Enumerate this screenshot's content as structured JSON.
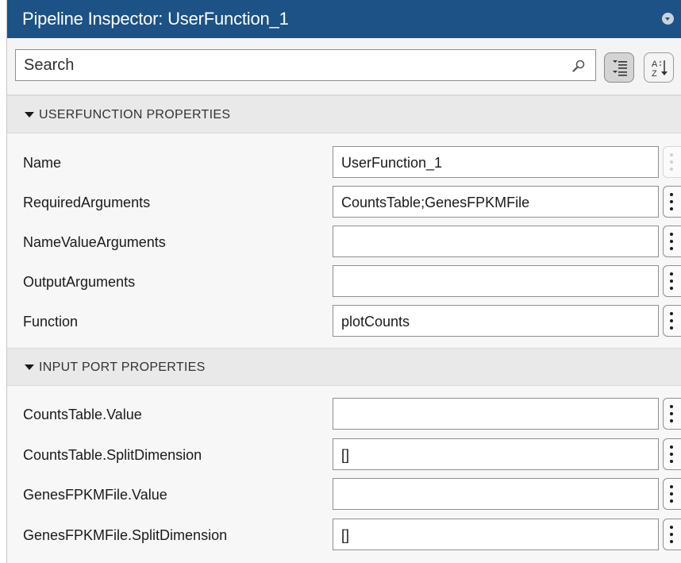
{
  "window": {
    "title": "Pipeline Inspector: UserFunction_1"
  },
  "search": {
    "placeholder": "Search",
    "value": ""
  },
  "toolbar": {
    "categorized_view": "categorized-view-icon",
    "alphabetical_view": "sort-alphabetical-icon"
  },
  "sections": [
    {
      "title": "USERFUNCTION PROPERTIES",
      "rows": [
        {
          "label": "Name",
          "value": "UserFunction_1",
          "more_enabled": false
        },
        {
          "label": "RequiredArguments",
          "value": "CountsTable;GenesFPKMFile",
          "more_enabled": true
        },
        {
          "label": "NameValueArguments",
          "value": "",
          "more_enabled": true
        },
        {
          "label": "OutputArguments",
          "value": "",
          "more_enabled": true
        },
        {
          "label": "Function",
          "value": "plotCounts",
          "more_enabled": true
        }
      ]
    },
    {
      "title": "INPUT PORT PROPERTIES",
      "rows": [
        {
          "label": "CountsTable.Value",
          "value": "",
          "more_enabled": true
        },
        {
          "label": "CountsTable.SplitDimension",
          "value": "[]",
          "more_enabled": true
        },
        {
          "label": "GenesFPKMFile.Value",
          "value": "",
          "more_enabled": true
        },
        {
          "label": "GenesFPKMFile.SplitDimension",
          "value": "[]",
          "more_enabled": true
        }
      ]
    }
  ],
  "colors": {
    "titlebar": "#1c5285",
    "section_header": "#e9e9e9",
    "panel": "#f7f7f7"
  }
}
